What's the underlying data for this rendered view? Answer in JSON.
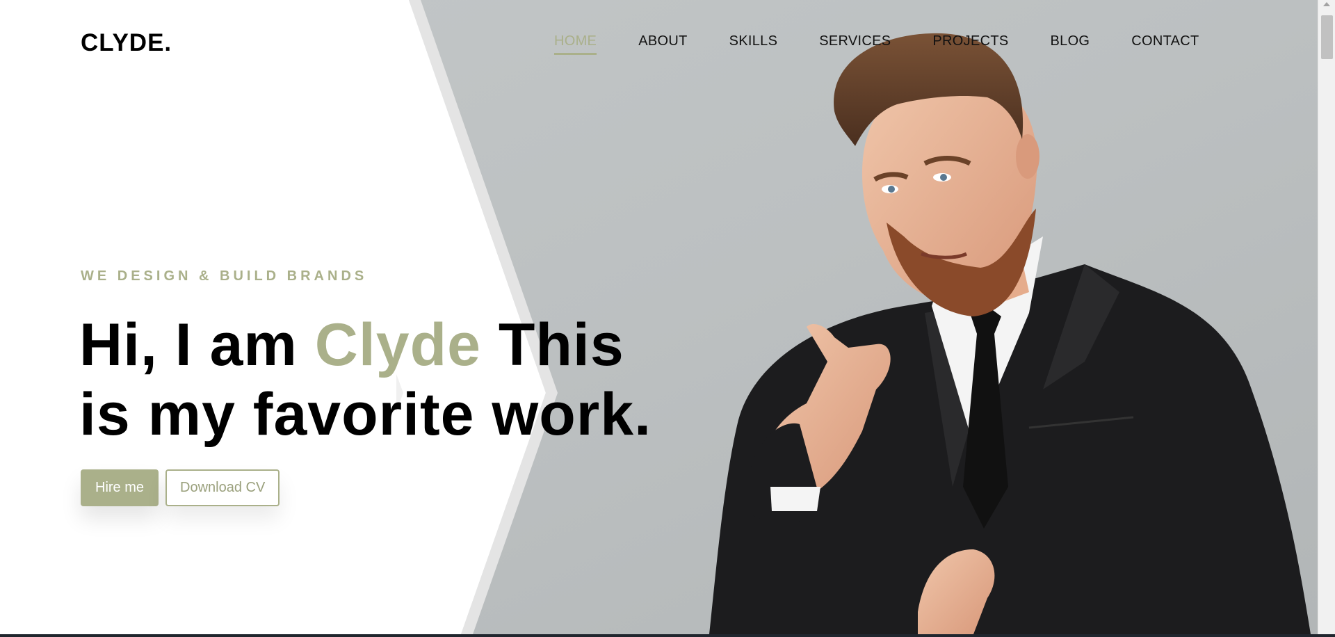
{
  "brand": {
    "logo": "CLYDE."
  },
  "nav": {
    "items": [
      {
        "label": "HOME",
        "active": true
      },
      {
        "label": "ABOUT",
        "active": false
      },
      {
        "label": "SKILLS",
        "active": false
      },
      {
        "label": "SERVICES",
        "active": false
      },
      {
        "label": "PROJECTS",
        "active": false
      },
      {
        "label": "BLOG",
        "active": false
      },
      {
        "label": "CONTACT",
        "active": false
      }
    ]
  },
  "hero": {
    "tagline": "WE DESIGN & BUILD BRANDS",
    "headline_part1": "Hi, I am ",
    "headline_name": "Clyde",
    "headline_part2": " This",
    "headline_line2": "is my favorite work.",
    "hire_button": "Hire me",
    "cv_button": "Download CV",
    "image_icon": "person-portrait-icon"
  },
  "colors": {
    "accent": "#aab08a",
    "text": "#000000",
    "photo_bg": "#bfc3c4"
  }
}
